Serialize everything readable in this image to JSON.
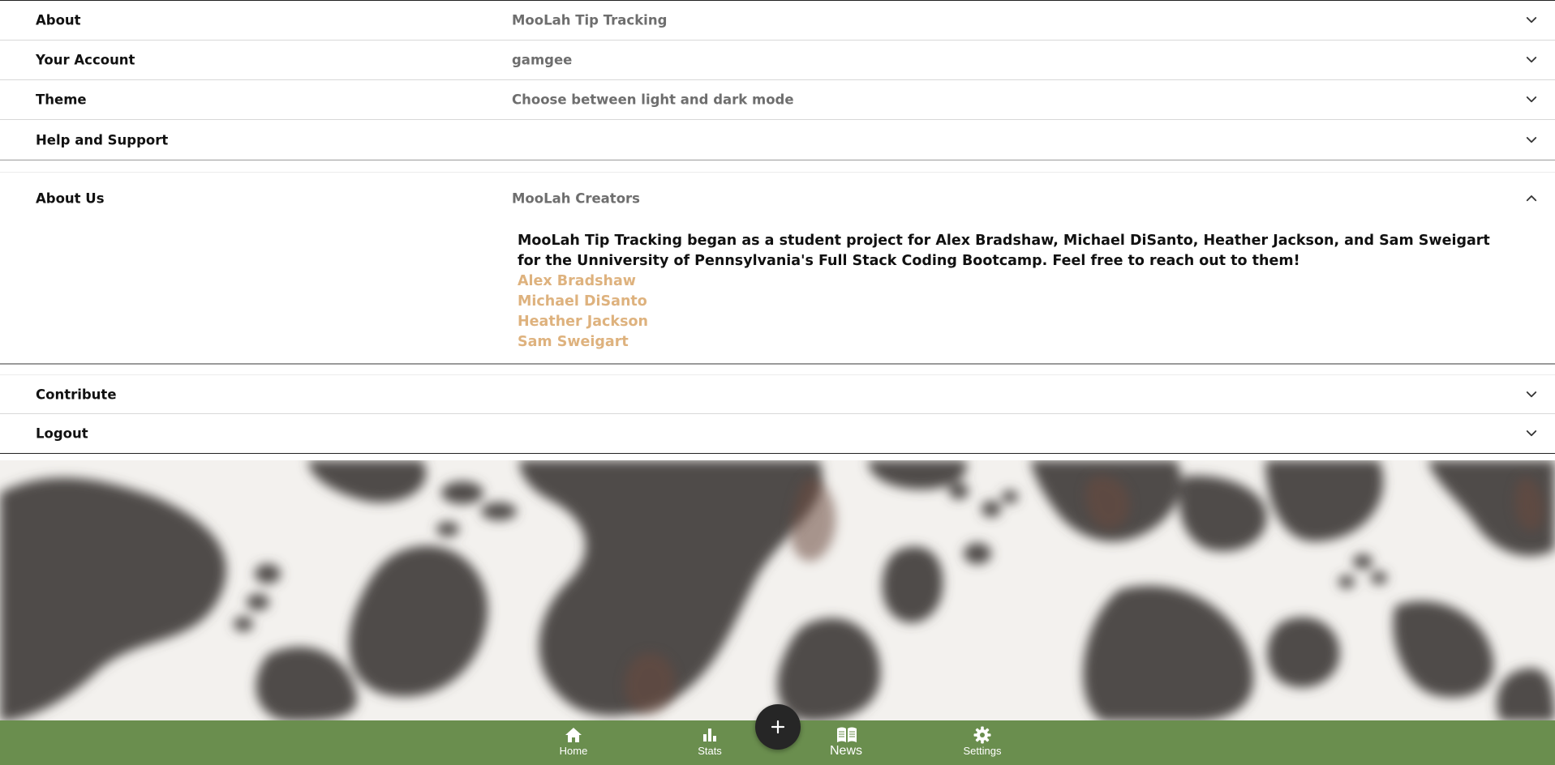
{
  "settings": {
    "rows": [
      {
        "label": "About",
        "summary": "MooLah Tip Tracking"
      },
      {
        "label": "Your Account",
        "summary": "gamgee"
      },
      {
        "label": "Theme",
        "summary": "Choose between light and dark mode"
      },
      {
        "label": "Help and Support",
        "summary": ""
      }
    ],
    "about_us": {
      "label": "About Us",
      "summary": "MooLah Creators",
      "description": "MooLah Tip Tracking began as a student project for Alex Bradshaw, Michael DiSanto, Heather Jackson, and Sam Sweigart for the Unniversity of Pennsylvania's Full Stack Coding Bootcamp. Feel free to reach out to them!",
      "links": [
        "Alex Bradshaw",
        "Michael DiSanto",
        "Heather Jackson",
        "Sam Sweigart"
      ]
    },
    "bottom_rows": [
      {
        "label": "Contribute"
      },
      {
        "label": "Logout"
      }
    ]
  },
  "navbar": {
    "items": [
      {
        "label": "Home",
        "icon": "home-icon"
      },
      {
        "label": "Stats",
        "icon": "bar-chart-icon"
      },
      {
        "label": "News",
        "icon": "book-icon",
        "active": true
      },
      {
        "label": "Settings",
        "icon": "gear-icon"
      }
    ],
    "fab_icon": "plus-icon"
  },
  "colors": {
    "navbar": "#6a8e4e",
    "link": "#deb27e",
    "fab": "#262626",
    "summary_text": "#6e6e6e"
  }
}
